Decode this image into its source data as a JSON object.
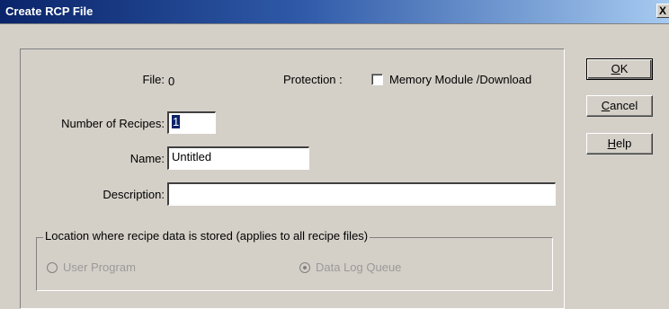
{
  "window": {
    "title": "Create RCP File",
    "close_glyph": "X"
  },
  "file": {
    "label": "File:",
    "value": "0"
  },
  "protection": {
    "label": "Protection :",
    "checkbox_label": "Memory Module /Download",
    "checked": false
  },
  "recipes": {
    "label": "Number of Recipes:",
    "value": "1"
  },
  "name": {
    "label": "Name:",
    "value": "Untitled"
  },
  "description": {
    "label": "Description:",
    "value": ""
  },
  "location": {
    "title": "Location where recipe data is stored  (applies to all recipe files)",
    "options": [
      {
        "label": "User Program",
        "selected": false,
        "enabled": false
      },
      {
        "label": "Data Log Queue",
        "selected": true,
        "enabled": false
      }
    ]
  },
  "buttons": {
    "ok": {
      "mnemonic": "O",
      "rest": "K"
    },
    "cancel": {
      "mnemonic": "C",
      "rest": "ancel"
    },
    "help": {
      "mnemonic": "H",
      "rest": "elp"
    }
  },
  "colors": {
    "title_gradient_start": "#0a246a",
    "title_gradient_end": "#a6caf0",
    "dialog_bg": "#d4d0c8"
  }
}
